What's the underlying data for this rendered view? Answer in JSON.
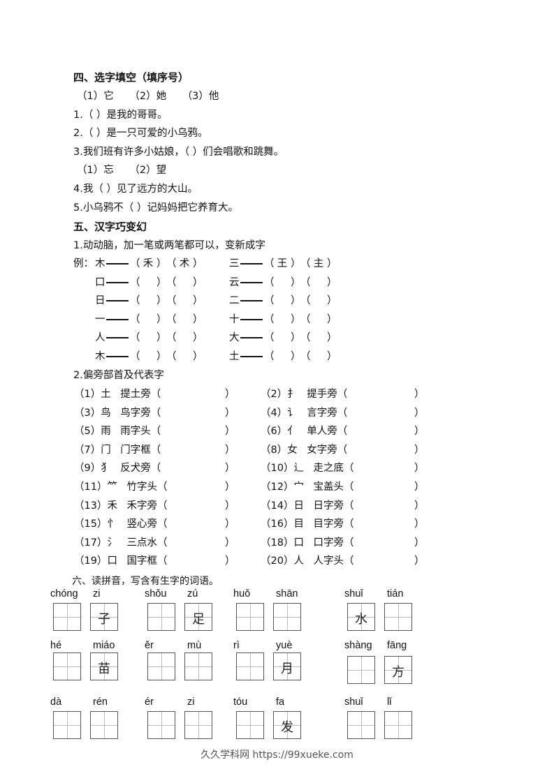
{
  "section4": {
    "title": "四、选字填空（填序号）",
    "options_a": [
      "（1）它",
      "（2）她",
      "（3）他"
    ],
    "questions_a": [
      "1.（  ）是我的哥哥。",
      "2.（  ）是一只可爱的小乌鸦。",
      "3.我们班有许多小姑娘，（  ）们会唱歌和跳舞。"
    ],
    "options_b": [
      "（1）忘",
      "（2）望"
    ],
    "questions_b": [
      "4.我（    ）见了远方的大山。",
      "5.小乌鸦不（  ）记妈妈把它养育大。"
    ]
  },
  "section5": {
    "title": "五、汉字巧变幻",
    "sub1_title": "1.动动脑，加一笔或两笔都可以，变新成字",
    "example_label": "例：",
    "rows": [
      {
        "left": {
          "char": "木",
          "a": "禾",
          "b": "术"
        },
        "right": {
          "char": "三",
          "a": "王",
          "b": "主"
        }
      },
      {
        "left": {
          "char": "口",
          "a": "",
          "b": ""
        },
        "right": {
          "char": "云",
          "a": "",
          "b": ""
        }
      },
      {
        "left": {
          "char": "日",
          "a": "",
          "b": ""
        },
        "right": {
          "char": "二",
          "a": "",
          "b": ""
        }
      },
      {
        "left": {
          "char": "一",
          "a": "",
          "b": ""
        },
        "right": {
          "char": "十",
          "a": "",
          "b": ""
        }
      },
      {
        "left": {
          "char": "人",
          "a": "",
          "b": ""
        },
        "right": {
          "char": "大",
          "a": "",
          "b": ""
        }
      },
      {
        "left": {
          "char": "木",
          "a": "",
          "b": ""
        },
        "right": {
          "char": "土",
          "a": "",
          "b": ""
        }
      }
    ],
    "sub2_title": "2.偏旁部首及代表字",
    "radicals": [
      {
        "num": "（1）",
        "sym": "土",
        "name": "提土旁（",
        "answer": ""
      },
      {
        "num": "（2）",
        "sym": "扌",
        "name": "提手旁（",
        "answer": ""
      },
      {
        "num": "（3）",
        "sym": "鸟",
        "name": "鸟字旁（",
        "answer": ""
      },
      {
        "num": "（4）",
        "sym": "讠",
        "name": "言字旁（",
        "answer": ""
      },
      {
        "num": "（5）",
        "sym": "雨",
        "name": "雨字头（",
        "answer": ""
      },
      {
        "num": "（6）",
        "sym": "亻",
        "name": "单人旁（",
        "answer": ""
      },
      {
        "num": "（7）",
        "sym": "门",
        "name": "门字框（",
        "answer": ""
      },
      {
        "num": "（8）",
        "sym": "女",
        "name": "女字旁（",
        "answer": ""
      },
      {
        "num": "（9）",
        "sym": "犭",
        "name": "反犬旁（",
        "answer": ""
      },
      {
        "num": "（10）",
        "sym": "辶",
        "name": "走之底（",
        "answer": ""
      },
      {
        "num": "（11）",
        "sym": "⺮",
        "name": "竹字头（",
        "answer": ""
      },
      {
        "num": "（12）",
        "sym": "宀",
        "name": "宝盖头（",
        "answer": ""
      },
      {
        "num": "（13）",
        "sym": "禾",
        "name": "禾字旁（",
        "answer": ""
      },
      {
        "num": "（14）",
        "sym": "日",
        "name": "日字旁（",
        "answer": ""
      },
      {
        "num": "（15）",
        "sym": "忄",
        "name": "竖心旁（",
        "answer": ""
      },
      {
        "num": "（16）",
        "sym": "目",
        "name": "目字旁（",
        "answer": ""
      },
      {
        "num": "（17）",
        "sym": "氵",
        "name": "三点水（",
        "answer": ""
      },
      {
        "num": "（18）",
        "sym": "口",
        "name": "口字旁（",
        "answer": ""
      },
      {
        "num": "（19）",
        "sym": "口",
        "name": "国字框（",
        "answer": ""
      },
      {
        "num": "（20）",
        "sym": "人",
        "name": "人字头（",
        "answer": ""
      }
    ],
    "close_paren": "）"
  },
  "section6": {
    "title": "六、读拼音，写含有生字的词语。",
    "words": [
      [
        {
          "py": "chóng",
          "c": ""
        },
        {
          "py": "zi",
          "c": "子"
        }
      ],
      [
        {
          "py": "shǒu",
          "c": ""
        },
        {
          "py": "zú",
          "c": "足"
        }
      ],
      [
        {
          "py": "huǒ",
          "c": ""
        },
        {
          "py": "shān",
          "c": ""
        }
      ],
      [
        {
          "py": "shuǐ",
          "c": "水"
        },
        {
          "py": "tián",
          "c": ""
        }
      ],
      [
        {
          "py": "hé",
          "c": ""
        },
        {
          "py": "miáo",
          "c": "苗"
        }
      ],
      [
        {
          "py": "ěr",
          "c": ""
        },
        {
          "py": "mù",
          "c": ""
        }
      ],
      [
        {
          "py": "rì",
          "c": ""
        },
        {
          "py": "yuè",
          "c": "月"
        }
      ],
      [
        {
          "py": "shàng",
          "c": ""
        },
        {
          "py": "fāng",
          "c": "方"
        }
      ],
      [
        {
          "py": "dà",
          "c": ""
        },
        {
          "py": "rén",
          "c": ""
        }
      ],
      [
        {
          "py": "ér",
          "c": ""
        },
        {
          "py": "zi",
          "c": ""
        }
      ],
      [
        {
          "py": "tóu",
          "c": ""
        },
        {
          "py": "fa",
          "c": "发"
        }
      ],
      [
        {
          "py": "shuǐ",
          "c": ""
        },
        {
          "py": "lǐ",
          "c": ""
        }
      ]
    ]
  },
  "footer": "久久学科网 https://99xueke.com"
}
